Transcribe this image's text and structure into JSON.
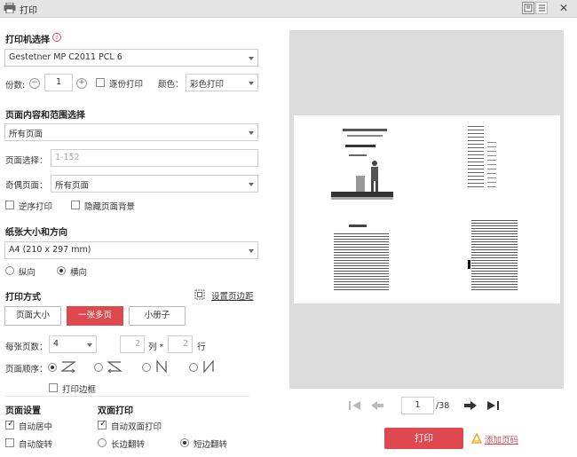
{
  "window": {
    "title": "打印",
    "close_label": "✕"
  },
  "printer": {
    "section_title": "打印机选择",
    "selected": "Gestetner MP C2011 PCL 6",
    "copies_label": "份数:",
    "copies_value": "1",
    "collate_label": "逐份打印",
    "color_label": "颜色：",
    "color_value": "彩色打印"
  },
  "range": {
    "section_title": "页面内容和范围选择",
    "content_value": "所有页面",
    "page_select_label": "页面选择：",
    "page_select_placeholder": "1-152",
    "odd_even_label": "奇偶页面：",
    "odd_even_value": "所有页面",
    "reverse_label": "逆序打印",
    "hide_bg_label": "隐藏页面背景"
  },
  "paper": {
    "section_title": "纸张大小和方向",
    "size_value": "A4 (210 x 297 mm)",
    "portrait_label": "纵向",
    "landscape_label": "横向",
    "orientation": "landscape"
  },
  "mode": {
    "section_title": "打印方式",
    "margin_link": "设置页边距",
    "buttons": [
      "页面大小",
      "一张多页",
      "小册子"
    ],
    "active_index": 1,
    "pages_per_sheet_label": "每张页数：",
    "pages_per_sheet_value": "4",
    "cols_value": "2",
    "cols_label": "列 *",
    "rows_value": "2",
    "rows_label": "行",
    "order_label": "页面顺序：",
    "border_label": "打印边框"
  },
  "page_setup": {
    "section_title": "页面设置",
    "auto_center_label": "自动居中",
    "auto_rotate_label": "自动旋转"
  },
  "duplex": {
    "section_title": "双面打印",
    "auto_duplex_label": "自动双面打印",
    "long_edge_label": "长边翻转",
    "short_edge_label": "短边翻转",
    "selected": "short"
  },
  "pager": {
    "current": "1",
    "total": "/38"
  },
  "actions": {
    "print_label": "打印",
    "add_pagenum_label": "添加页码"
  },
  "colors": {
    "accent": "#e0484f"
  }
}
